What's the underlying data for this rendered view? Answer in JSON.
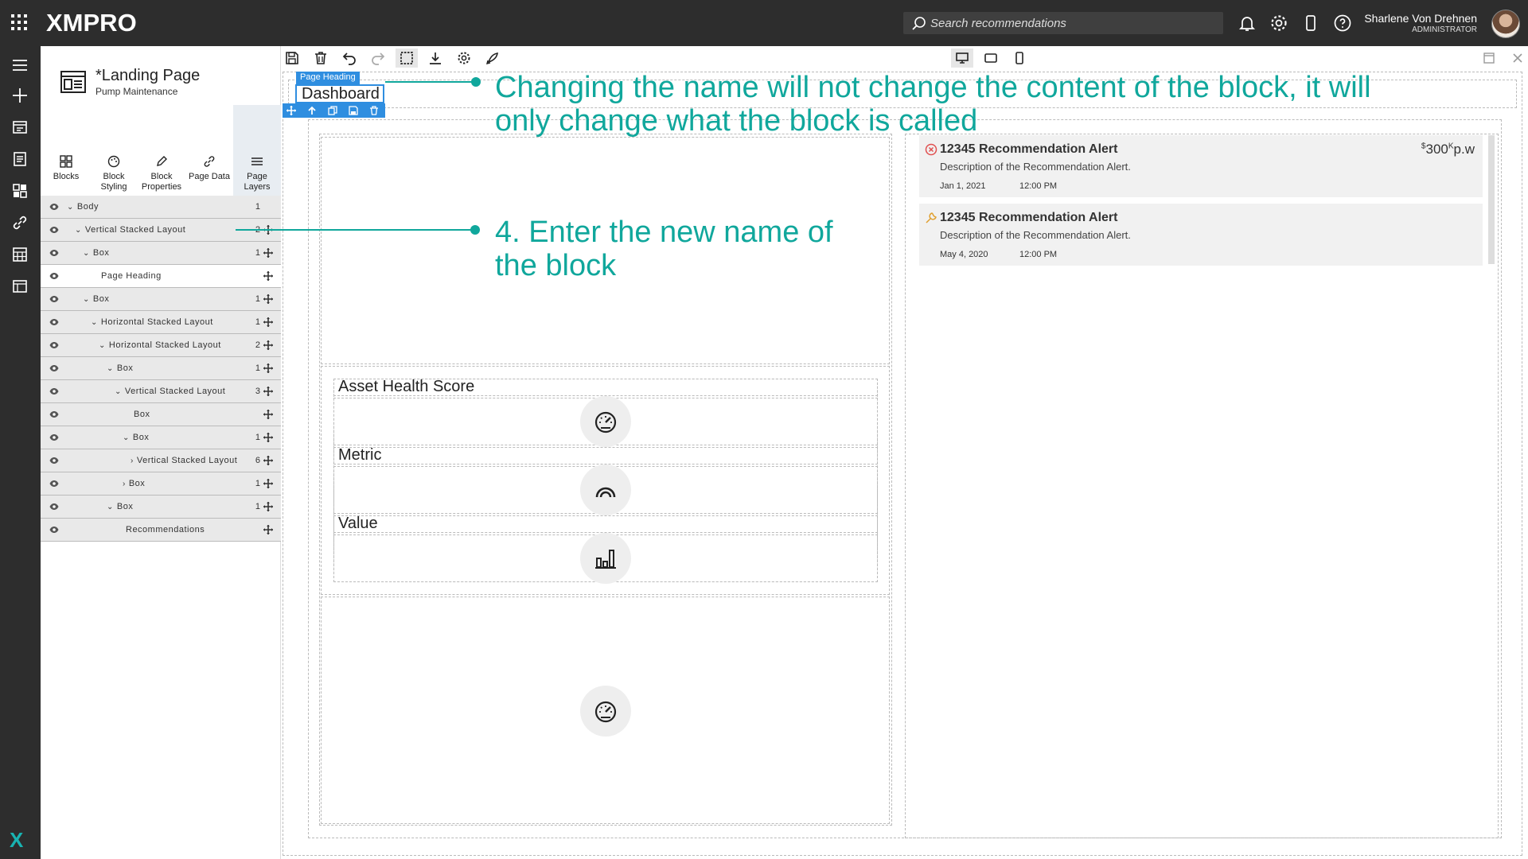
{
  "app": {
    "logo": "XMPRO",
    "search_placeholder": "Search recommendations",
    "user_name": "Sharlene Von Drehnen",
    "user_role": "ADMINISTRATOR"
  },
  "page": {
    "title": "*Landing Page",
    "subtitle": "Pump Maintenance"
  },
  "tabs": [
    {
      "label": "Blocks"
    },
    {
      "label": "Block Styling"
    },
    {
      "label": "Block Properties"
    },
    {
      "label": "Page Data"
    },
    {
      "label": "Page Layers"
    }
  ],
  "layers": [
    {
      "label": "Body",
      "count": "1",
      "chev": "⌄"
    },
    {
      "label": "Vertical Stacked Layout",
      "count": "2",
      "chev": "⌄"
    },
    {
      "label": "Box",
      "count": "1",
      "chev": "⌄"
    },
    {
      "label": "Page Heading",
      "count": "",
      "chev": ""
    },
    {
      "label": "Box",
      "count": "1",
      "chev": "⌄"
    },
    {
      "label": "Horizontal Stacked Layout",
      "count": "1",
      "chev": "⌄"
    },
    {
      "label": "Horizontal Stacked Layout",
      "count": "2",
      "chev": "⌄"
    },
    {
      "label": "Box",
      "count": "1",
      "chev": "⌄"
    },
    {
      "label": "Vertical Stacked Layout",
      "count": "3",
      "chev": "⌄"
    },
    {
      "label": "Box",
      "count": "",
      "chev": ""
    },
    {
      "label": "Box",
      "count": "1",
      "chev": "⌄"
    },
    {
      "label": "Vertical Stacked Layout",
      "count": "6",
      "chev": "›"
    },
    {
      "label": "Box",
      "count": "1",
      "chev": "›"
    },
    {
      "label": "Box",
      "count": "1",
      "chev": "⌄"
    },
    {
      "label": "Recommendations",
      "count": "",
      "chev": ""
    }
  ],
  "canvas": {
    "heading_tag": "Page Heading",
    "heading_value": "Dashboard",
    "sections": {
      "asset_health": "Asset Health Score",
      "metric": "Metric",
      "value": "Value"
    }
  },
  "annotations": {
    "top": "Changing the name will not change the content of the block, it will only change what the block is called",
    "step": "4. Enter the new name of the block"
  },
  "recommendations": [
    {
      "title": "12345 Recommendation Alert",
      "description": "Description of the Recommendation Alert.",
      "date": "Jan 1, 2021",
      "time": "12:00 PM",
      "price_prefix": "$",
      "price": "300",
      "price_unit": "K",
      "price_suffix": "p.w",
      "icon": "error-circle-icon"
    },
    {
      "title": "12345 Recommendation Alert",
      "description": "Description of the Recommendation Alert.",
      "date": "May 4, 2020",
      "time": "12:00 PM",
      "icon": "wrench-icon"
    }
  ],
  "colors": {
    "accent": "#10a79c",
    "selection": "#2f8ee0",
    "topbar": "#2d2d2d",
    "error": "#e05050",
    "warning": "#e0a030"
  }
}
